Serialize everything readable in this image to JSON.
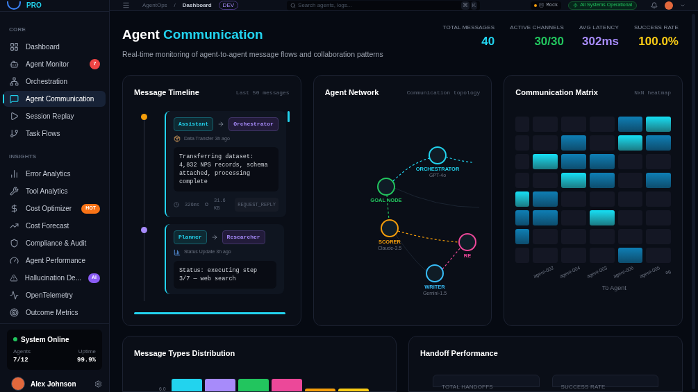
{
  "brand": {
    "tier": "PRO"
  },
  "topbar": {
    "breadcrumb": [
      "AgentOps",
      "Dashboard"
    ],
    "breadcrumb_separator": "/",
    "env_badge": "DEV",
    "search": {
      "placeholder": "Search agents, logs...",
      "shortcut": [
        "⌘",
        "K"
      ]
    },
    "data_source": "Mock",
    "status": "All Systems Operational"
  },
  "sidebar": {
    "sections": [
      {
        "title": "CORE",
        "items": [
          {
            "label": "Dashboard",
            "selected": false
          },
          {
            "label": "Agent Monitor",
            "selected": false,
            "badge": {
              "text": "7",
              "kind": "count"
            }
          },
          {
            "label": "Orchestration",
            "selected": false
          },
          {
            "label": "Agent Communication",
            "selected": true
          },
          {
            "label": "Session Replay",
            "selected": false
          },
          {
            "label": "Task Flows",
            "selected": false
          }
        ]
      },
      {
        "title": "INSIGHTS",
        "items": [
          {
            "label": "Error Analytics",
            "selected": false
          },
          {
            "label": "Tool Analytics",
            "selected": false
          },
          {
            "label": "Cost Optimizer",
            "selected": false,
            "badge": {
              "text": "HOT",
              "kind": "hot"
            }
          },
          {
            "label": "Cost Forecast",
            "selected": false
          },
          {
            "label": "Compliance & Audit",
            "selected": false
          },
          {
            "label": "Agent Performance",
            "selected": false
          },
          {
            "label": "Hallucination De...",
            "selected": false,
            "badge": {
              "text": "AI",
              "kind": "ai"
            }
          },
          {
            "label": "OpenTelemetry",
            "selected": false
          },
          {
            "label": "Outcome Metrics",
            "selected": false
          }
        ]
      }
    ],
    "system": {
      "status": "System Online",
      "online": true,
      "agents_label": "Agents",
      "agents": "7/12",
      "uptime_label": "Uptime",
      "uptime": "99.9%"
    },
    "user": {
      "name": "Alex Johnson"
    }
  },
  "page": {
    "title_plain": "Agent",
    "title_accent": "Communication",
    "subtitle": "Real-time monitoring of agent-to-agent message flows and collaboration patterns"
  },
  "stats": [
    {
      "label": "TOTAL MESSAGES",
      "value": "40",
      "color": "#22d3ee"
    },
    {
      "label": "ACTIVE CHANNELS",
      "value": "30/30",
      "color": "#22c55e"
    },
    {
      "label": "AVG LATENCY",
      "value": "302ms",
      "color": "#a78bfa"
    },
    {
      "label": "SUCCESS RATE",
      "value": "100.0%",
      "color": "#facc15"
    }
  ],
  "timeline": {
    "title": "Message Timeline",
    "hint": "Last 50 messages",
    "messages": [
      {
        "from": "Assistant",
        "to": "Orchestrator",
        "type": "Data Transfer",
        "time": "3h ago",
        "color": "#f59e0b",
        "body": "Transferring dataset: 4,832 NPS records, schema attached, processing complete",
        "latency": "326ms",
        "size": "31.6 KB",
        "pattern": "REQUEST_REPLY"
      },
      {
        "from": "Planner",
        "to": "Researcher",
        "type": "Status Update",
        "time": "3h ago",
        "color": "#a78bfa",
        "body": "Status: executing step 3/7 — web search"
      }
    ]
  },
  "network": {
    "title": "Agent Network",
    "hint": "Communication topology",
    "nodes": [
      {
        "name": "ORCHESTRATOR",
        "model": "GPT-4o",
        "color": "#22d3ee"
      },
      {
        "name": "GOAL NODE",
        "color": "#22c55e"
      },
      {
        "name": "SCORER",
        "model": "Claude-3.5",
        "color": "#f59e0b"
      },
      {
        "name": "WRITER",
        "model": "Gemini-1.5",
        "color": "#38bdf8"
      },
      {
        "name": "RE",
        "color": "#ec4899"
      }
    ]
  },
  "matrix": {
    "title": "Communication Matrix",
    "hint": "NxN heatmap",
    "rows": [
      [
        {
          "kind": "empty"
        },
        {
          "kind": "empty"
        },
        {
          "kind": "empty"
        },
        {
          "kind": "empty"
        },
        {
          "kind": "medium"
        },
        {
          "kind": "high"
        }
      ],
      [
        {
          "kind": "empty"
        },
        {
          "kind": "empty"
        },
        {
          "kind": "medium"
        },
        {
          "kind": "empty"
        },
        {
          "kind": "high"
        },
        {
          "kind": "medium"
        }
      ],
      [
        {
          "kind": "empty"
        },
        {
          "kind": "high"
        },
        {
          "kind": "medium"
        },
        {
          "kind": "medium"
        },
        {
          "kind": "empty"
        },
        {
          "kind": "empty"
        }
      ],
      [
        {
          "kind": "empty"
        },
        {
          "kind": "empty"
        },
        {
          "kind": "high"
        },
        {
          "kind": "medium"
        },
        {
          "kind": "empty"
        },
        {
          "kind": "medium"
        }
      ],
      [
        {
          "kind": "high"
        },
        {
          "kind": "medium"
        },
        {
          "kind": "empty"
        },
        {
          "kind": "empty"
        },
        {
          "kind": "empty"
        },
        {
          "kind": "empty"
        }
      ],
      [
        {
          "kind": "medium"
        },
        {
          "kind": "medium"
        },
        {
          "kind": "empty"
        },
        {
          "kind": "high"
        },
        {
          "kind": "empty"
        },
        {
          "kind": "empty"
        }
      ],
      [
        {
          "kind": "medium"
        },
        {
          "kind": "empty"
        },
        {
          "kind": "empty"
        },
        {
          "kind": "empty"
        },
        {
          "kind": "empty"
        },
        {
          "kind": "empty"
        }
      ],
      [
        {
          "kind": "empty"
        },
        {
          "kind": "empty"
        },
        {
          "kind": "empty"
        },
        {
          "kind": "empty"
        },
        {
          "kind": "medium"
        },
        {
          "kind": "empty"
        }
      ]
    ],
    "column_labels": [
      "agent-002",
      "agent-004",
      "agent-003",
      "agent-006",
      "agent-005",
      "ag"
    ],
    "axis_label": "To Agent"
  },
  "distribution": {
    "title": "Message Types Distribution",
    "y_tick": "6.0",
    "bars": [
      {
        "color": "#22d3ee"
      },
      {
        "color": "#a78bfa"
      },
      {
        "color": "#22c55e"
      },
      {
        "color": "#ec4899"
      },
      {
        "color": "#f59e0b"
      },
      {
        "color": "#facc15"
      }
    ]
  },
  "handoff": {
    "title": "Handoff Performance",
    "tiles": [
      "TOTAL HANDOFFS",
      "SUCCESS RATE"
    ]
  }
}
